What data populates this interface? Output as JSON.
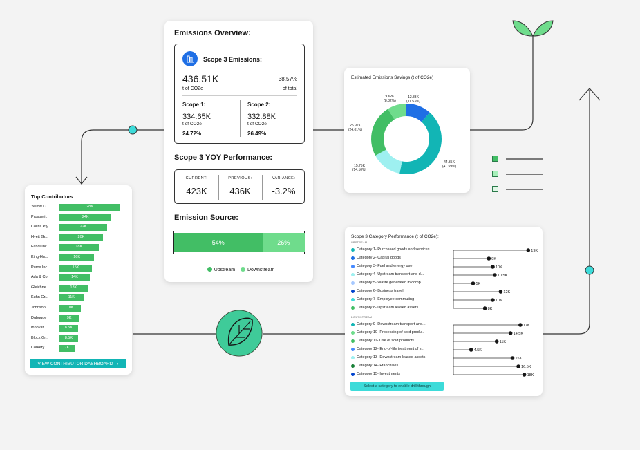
{
  "colors": {
    "green": "#42be65",
    "light_green": "#6fdc8c",
    "teal": "#12b5b5",
    "cyan": "#3ddbd9",
    "blue": "#1f6fe5",
    "pale_cyan": "#9ef0f0",
    "connector": "#3ddbd9",
    "line": "#333333"
  },
  "top_contributors": {
    "title": "Top Contributors:",
    "button_label": "VIEW CONTRIBUTOR DASHBOARD",
    "button_icon": "chevron-right-icon",
    "rows": [
      {
        "name": "Yellow C...",
        "label": "28K",
        "value": 28
      },
      {
        "name": "Prosperi...",
        "label": "24K",
        "value": 24
      },
      {
        "name": "Colins Pty",
        "label": "22K",
        "value": 22
      },
      {
        "name": "Hyett Gr...",
        "label": "20K",
        "value": 20
      },
      {
        "name": "Fandi Inc",
        "label": "18K",
        "value": 18
      },
      {
        "name": "King-Hu...",
        "label": "16K",
        "value": 16
      },
      {
        "name": "Purox Inc",
        "label": "15K",
        "value": 15
      },
      {
        "name": "Ada & Co",
        "label": "14K",
        "value": 14
      },
      {
        "name": "Gleichne...",
        "label": "13K",
        "value": 13
      },
      {
        "name": "Kuhn Gr...",
        "label": "11K",
        "value": 11
      },
      {
        "name": "Johnson...",
        "label": "10K",
        "value": 10
      },
      {
        "name": "Dubuque",
        "label": "9K",
        "value": 9
      },
      {
        "name": "Innovat...",
        "label": "8.5K",
        "value": 8.5
      },
      {
        "name": "Block Gr...",
        "label": "8.5K",
        "value": 8.5
      },
      {
        "name": "Corkery...",
        "label": "7K",
        "value": 7
      }
    ]
  },
  "overview": {
    "title": "Emissions Overview:",
    "scope3": {
      "title": "Scope 3 Emissions:",
      "icon": "building-icon",
      "value": "436.51K",
      "unit": "t of CO2e",
      "percent": "38.57%",
      "percent_label": "of total"
    },
    "scope1": {
      "title": "Scope 1:",
      "value": "334.65K",
      "unit": "t of CO2e",
      "percent": "24.72%"
    },
    "scope2": {
      "title": "Scope 2:",
      "value": "332.88K",
      "unit": "t of CO2e",
      "percent": "26.49%"
    },
    "yoy": {
      "title": "Scope 3 YOY Performance:",
      "current_label": "CURRENT:",
      "current_value": "423K",
      "previous_label": "PREVIOUS:",
      "previous_value": "436K",
      "variance_label": "VARIANCE:",
      "variance_value": "-3.2%"
    },
    "source": {
      "title": "Emission Source:",
      "upstream_pct": 54,
      "upstream_label": "54%",
      "downstream_pct": 26,
      "downstream_label": "26%",
      "legend_upstream": "Upstream",
      "legend_downstream": "Downstream"
    }
  },
  "savings": {
    "title": "Estimated Emissions Savings (t of CO2e)",
    "chart_data": {
      "type": "pie",
      "slices": [
        {
          "value_label": "12.83K",
          "pct_label": "(11.53%)",
          "value": 11.53,
          "color": "#1f6fe5"
        },
        {
          "value_label": "44.35K",
          "pct_label": "(41.59%)",
          "value": 41.59,
          "color": "#12b5b5"
        },
        {
          "value_label": "15.75K",
          "pct_label": "(14.10%)",
          "value": 14.1,
          "color": "#9ef0f0"
        },
        {
          "value_label": "25.92K",
          "pct_label": "(24.01%)",
          "value": 24.01,
          "color": "#42be65"
        },
        {
          "value_label": "9.62K",
          "pct_label": "(8.82%)",
          "value": 8.82,
          "color": "#6fdc8c"
        }
      ]
    }
  },
  "categories": {
    "title": "Scope 3 Category Performance (t of CO2e):",
    "upstream_label": "UPSTREAM",
    "downstream_label": "DOWNSTREAM",
    "button_label": "Select a category to enable drill through",
    "upstream": [
      {
        "label": "Category 1- Purchased goods and services",
        "value_label": "19K",
        "value": 19,
        "color": "#12b5b5"
      },
      {
        "label": "Category 2- Capital goods",
        "value_label": "9K",
        "value": 9,
        "color": "#1f6fe5"
      },
      {
        "label": "Category 3- Fuel and energy use",
        "value_label": "10K",
        "value": 10,
        "color": "#4589ff"
      },
      {
        "label": "Category 4- Upstream transport and d...",
        "value_label": "10.5K",
        "value": 10.5,
        "color": "#9ef0f0"
      },
      {
        "label": "Category 5- Waste generated in comp...",
        "value_label": "5K",
        "value": 5,
        "color": "#a6c8ff"
      },
      {
        "label": "Category 6- Business travel",
        "value_label": "12K",
        "value": 12,
        "color": "#0043ce"
      },
      {
        "label": "Category 7- Employee commuting",
        "value_label": "10K",
        "value": 10,
        "color": "#3ddbd9"
      },
      {
        "label": "Category 8- Upstream leased assets",
        "value_label": "8K",
        "value": 8,
        "color": "#42be65"
      }
    ],
    "downstream": [
      {
        "label": "Category 9- Downstream transport and...",
        "value_label": "17K",
        "value": 17,
        "color": "#12b5b5"
      },
      {
        "label": "Category 10- Processing of sold produ...",
        "value_label": "14.5K",
        "value": 14.5,
        "color": "#6fdc8c"
      },
      {
        "label": "Category 11- Use of sold products",
        "value_label": "11K",
        "value": 11,
        "color": "#42be65"
      },
      {
        "label": "Category 12- End-of-life treatment of s...",
        "value_label": "4.5K",
        "value": 4.5,
        "color": "#4589ff"
      },
      {
        "label": "Category 13- Downstream leased assets",
        "value_label": "15K",
        "value": 15,
        "color": "#9ef0f0"
      },
      {
        "label": "Category 14- Franchises",
        "value_label": "16.5K",
        "value": 16.5,
        "color": "#198038"
      },
      {
        "label": "Category 15- Investments",
        "value_label": "18K",
        "value": 18,
        "color": "#0043ce"
      }
    ]
  }
}
